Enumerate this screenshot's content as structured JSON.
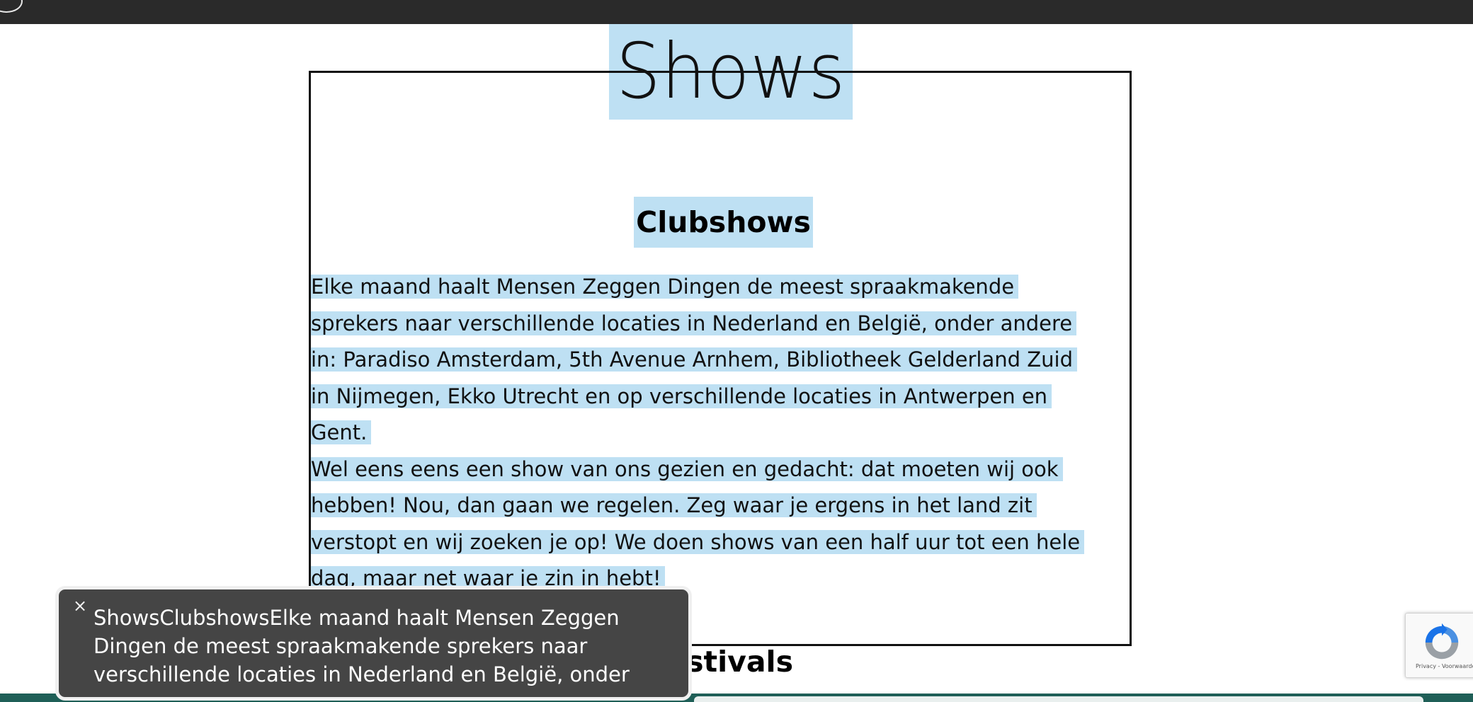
{
  "page": {
    "title": "Shows",
    "section_title": "Clubshows",
    "paragraphs": [
      [
        "Elke maand haalt Mensen Zeggen Dingen de meest spraakmakende",
        "sprekers naar verschillende locaties in Nederland en België, onder andere",
        "in: Paradiso Amsterdam, 5th Avenue Arnhem, Bibliotheek Gelderland Zuid",
        "in Nijmegen, Ekko Utrecht en op verschillende locaties in Antwerpen en",
        "Gent."
      ],
      [
        "Wel eens eens een show van ons gezien en gedacht: dat moeten wij ook",
        "hebben! Nou, dan gaan we regelen. Zeg waar je ergens in het land zit",
        "verstopt en wij zoeken je op! We doen shows van een half uur tot een hele",
        "dag, maar net waar je zin in hebt!"
      ]
    ],
    "next_section_title_partial": "stivals"
  },
  "toast": {
    "close_icon": "close-icon",
    "text": "ShowsClubshowsElke maand haalt Mensen Zeggen Dingen de meest spraakmakende sprekers naar verschillende locaties in Nederland en België, onder"
  },
  "recaptcha": {
    "links": "Privacy - Voorwaarden",
    "icon": "recaptcha-icon"
  },
  "colors": {
    "selection_highlight": "#bee0f3",
    "top_bar": "#2a2a2a",
    "toast_background": "#454545",
    "bottom_strip": "#1f5f57"
  }
}
